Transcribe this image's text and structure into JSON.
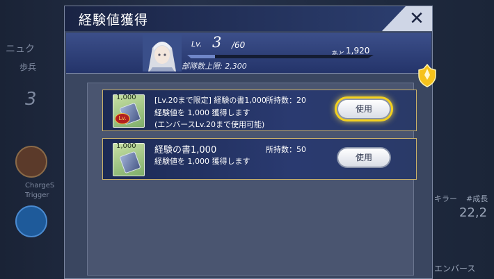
{
  "background": {
    "left_labels": [
      "ニュク",
      "歩兵"
    ],
    "left_level": "3",
    "left_char_label": "ChargeS",
    "left_char_sub": "Trigger",
    "right_labels": [
      "#成長",
      "キラー",
      "エンバース"
    ],
    "right_value": "22,2"
  },
  "dialog": {
    "title": "経験値獲得",
    "close_symbol": "✕"
  },
  "status": {
    "lv_label": "Lv.",
    "level": "3",
    "max_level": "/60",
    "remaining_label": "あと",
    "remaining_value": "1,920",
    "troop_limit": "部隊数上限: 2,300",
    "exp_progress": 0.15
  },
  "items": [
    {
      "icon_value": "1,000",
      "icon_badge": "Lv.",
      "line1": "[Lv.20まで限定] 経験の書1,000",
      "owned": "所持数：20",
      "line2": "経験値を 1,000 獲得します",
      "line3": "(エンバースLv.20まで使用可能)",
      "button_label": "使用",
      "highlighted": true
    },
    {
      "icon_value": "1,000",
      "name": "経験の書1,000",
      "owned": "所持数：50",
      "line2": "経験値を 1,000 獲得します",
      "button_label": "使用",
      "highlighted": false
    }
  ],
  "colors": {
    "highlight": "#f4d11e",
    "item_border": "#c9b06a",
    "title_bar": "#1a2444"
  }
}
